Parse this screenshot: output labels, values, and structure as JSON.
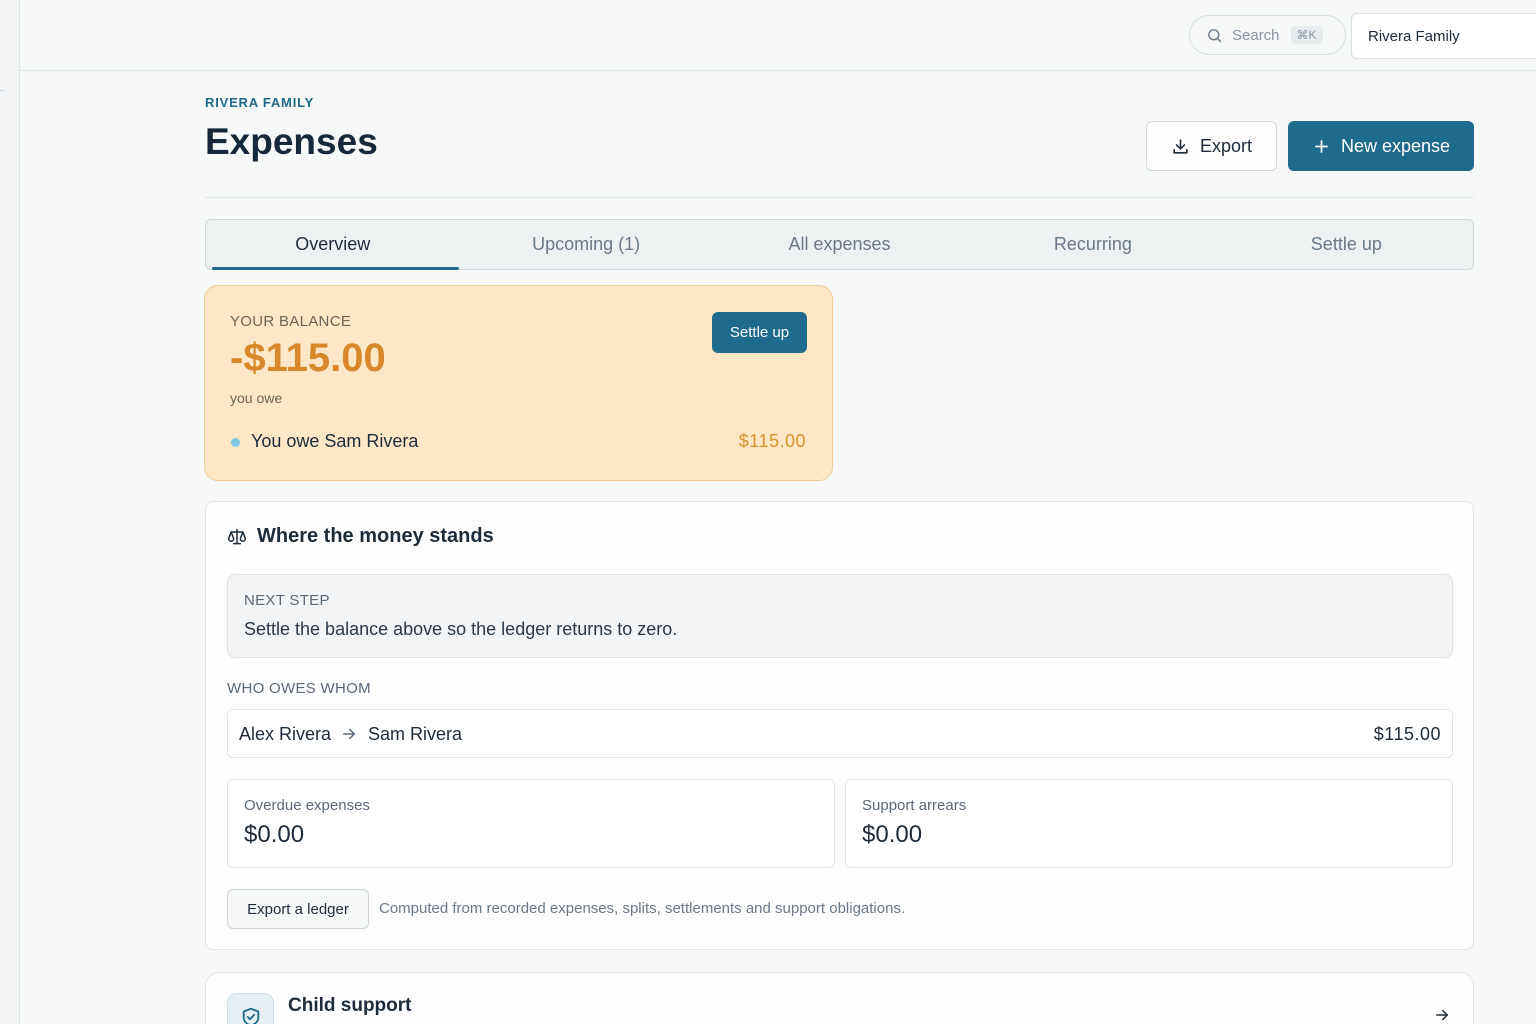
{
  "topbar": {
    "search_placeholder": "Search",
    "search_shortcut": "⌘K",
    "family_selector": "Rivera Family"
  },
  "header": {
    "eyebrow": "RIVERA FAMILY",
    "title": "Expenses",
    "export_label": "Export",
    "new_expense_label": "New expense"
  },
  "tabs": [
    {
      "label": "Overview",
      "active": true
    },
    {
      "label": "Upcoming (1)",
      "active": false
    },
    {
      "label": "All expenses",
      "active": false
    },
    {
      "label": "Recurring",
      "active": false
    },
    {
      "label": "Settle up",
      "active": false
    }
  ],
  "balance": {
    "label": "YOUR BALANCE",
    "amount": "-$115.00",
    "sub": "you owe",
    "settle_label": "Settle up",
    "owe_text": "You owe Sam Rivera",
    "owe_amount": "$115.00"
  },
  "standings": {
    "title": "Where the money stands",
    "next_step_label": "NEXT STEP",
    "next_step_text": "Settle the balance above so the ledger returns to zero.",
    "who_owes_label": "WHO OWES WHOM",
    "who_owes": {
      "from": "Alex Rivera",
      "to": "Sam Rivera",
      "amount": "$115.00"
    },
    "overdue_label": "Overdue expenses",
    "overdue_value": "$0.00",
    "arrears_label": "Support arrears",
    "arrears_value": "$0.00",
    "ledger_button": "Export a ledger",
    "ledger_note": "Computed from recorded expenses, splits, settlements and support obligations."
  },
  "child_support": {
    "title": "Child support"
  },
  "colors": {
    "accent": "#1e6b8d",
    "balance_bg": "#fde7c7",
    "balance_amount": "#d8872a"
  }
}
